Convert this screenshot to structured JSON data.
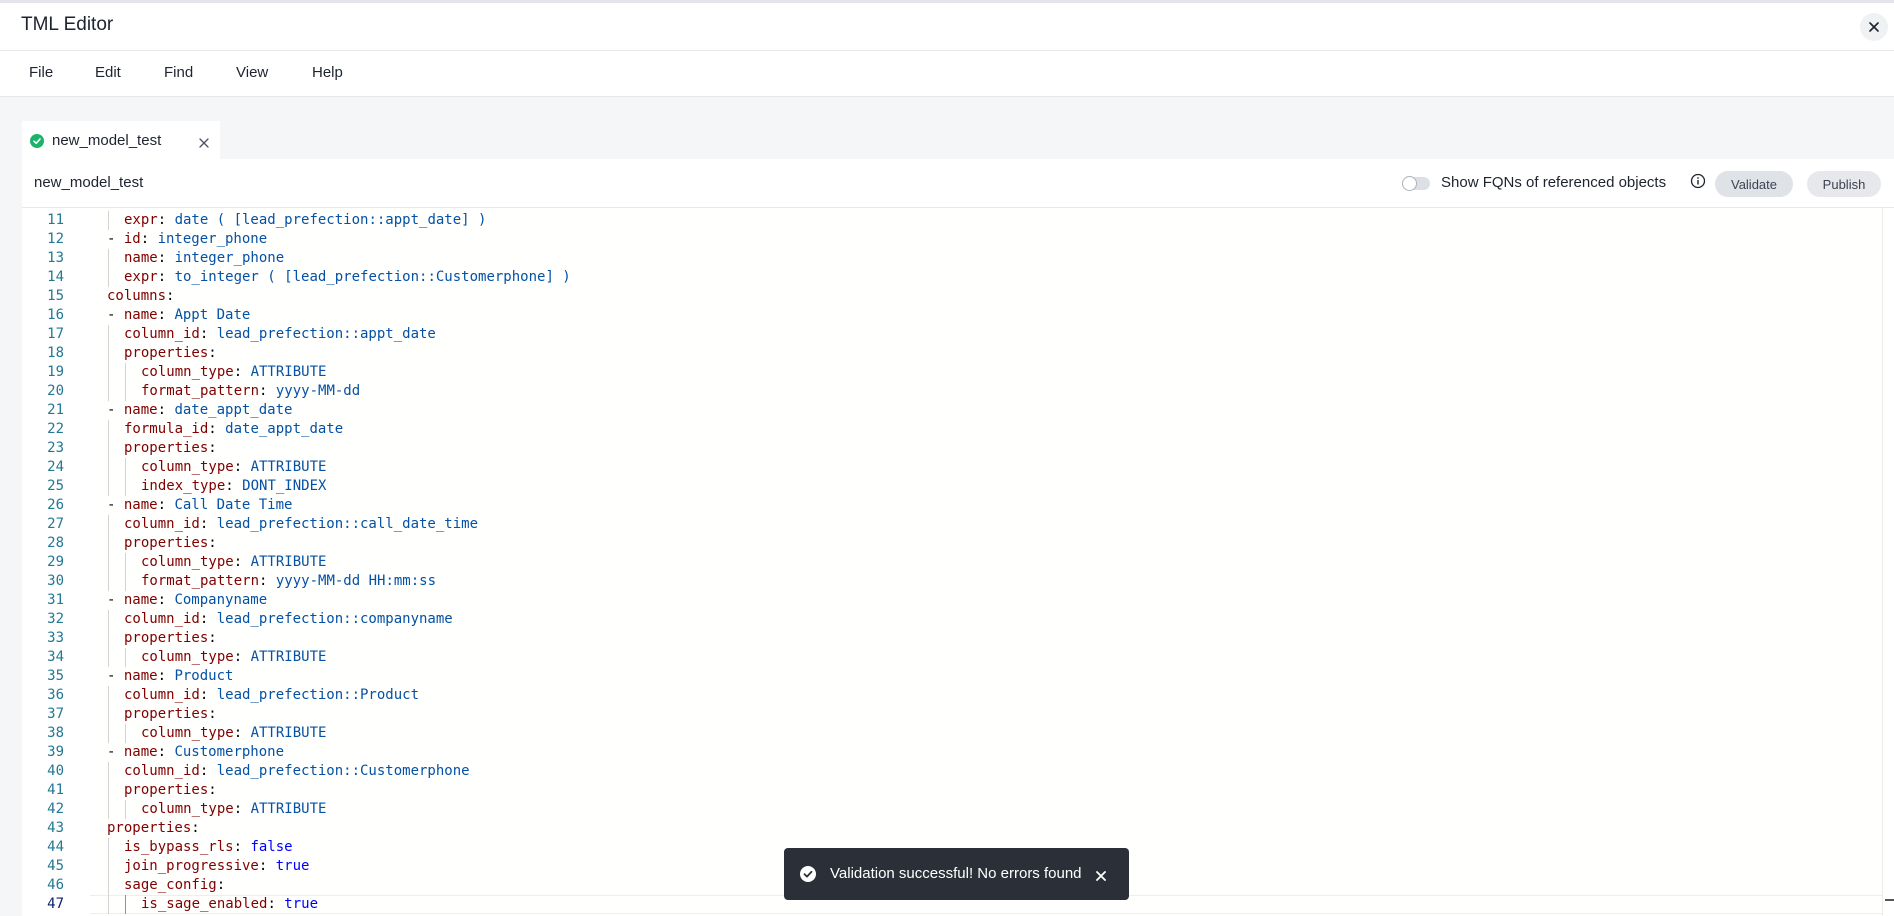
{
  "window": {
    "title": "TML Editor"
  },
  "menu": [
    "File",
    "Edit",
    "Find",
    "View",
    "Help"
  ],
  "tab": {
    "label": "new_model_test",
    "status": "valid"
  },
  "toolbar": {
    "file_name": "new_model_test",
    "fqn_toggle_label": "Show FQNs of referenced objects",
    "fqn_toggle_on": false,
    "validate_label": "Validate",
    "publish_label": "Publish"
  },
  "editor": {
    "active_line": 47,
    "lines": [
      {
        "n": "11",
        "depth": 1,
        "tokens": [
          {
            "t": "expr",
            "c": "k"
          },
          {
            "t": ": ",
            "c": "p"
          },
          {
            "t": "date ( [lead_prefection::appt_date] )",
            "c": "str"
          }
        ]
      },
      {
        "n": "12",
        "depth": 0,
        "tokens": [
          {
            "t": "- ",
            "c": "p"
          },
          {
            "t": "id",
            "c": "k"
          },
          {
            "t": ": ",
            "c": "p"
          },
          {
            "t": "integer_phone",
            "c": "str"
          }
        ]
      },
      {
        "n": "13",
        "depth": 1,
        "tokens": [
          {
            "t": "name",
            "c": "k"
          },
          {
            "t": ": ",
            "c": "p"
          },
          {
            "t": "integer_phone",
            "c": "str"
          }
        ]
      },
      {
        "n": "14",
        "depth": 1,
        "tokens": [
          {
            "t": "expr",
            "c": "k"
          },
          {
            "t": ": ",
            "c": "p"
          },
          {
            "t": "to_integer ( [lead_prefection::Customerphone] )",
            "c": "str"
          }
        ]
      },
      {
        "n": "15",
        "depth": 0,
        "tokens": [
          {
            "t": "columns",
            "c": "k"
          },
          {
            "t": ":",
            "c": "p"
          }
        ]
      },
      {
        "n": "16",
        "depth": 0,
        "tokens": [
          {
            "t": "- ",
            "c": "p"
          },
          {
            "t": "name",
            "c": "k"
          },
          {
            "t": ": ",
            "c": "p"
          },
          {
            "t": "Appt Date",
            "c": "str"
          }
        ]
      },
      {
        "n": "17",
        "depth": 1,
        "tokens": [
          {
            "t": "column_id",
            "c": "k"
          },
          {
            "t": ": ",
            "c": "p"
          },
          {
            "t": "lead_prefection::appt_date",
            "c": "str"
          }
        ]
      },
      {
        "n": "18",
        "depth": 1,
        "tokens": [
          {
            "t": "properties",
            "c": "k"
          },
          {
            "t": ":",
            "c": "p"
          }
        ]
      },
      {
        "n": "19",
        "depth": 2,
        "tokens": [
          {
            "t": "column_type",
            "c": "k"
          },
          {
            "t": ": ",
            "c": "p"
          },
          {
            "t": "ATTRIBUTE",
            "c": "str"
          }
        ]
      },
      {
        "n": "20",
        "depth": 2,
        "tokens": [
          {
            "t": "format_pattern",
            "c": "k"
          },
          {
            "t": ": ",
            "c": "p"
          },
          {
            "t": "yyyy-MM-dd",
            "c": "str"
          }
        ]
      },
      {
        "n": "21",
        "depth": 0,
        "tokens": [
          {
            "t": "- ",
            "c": "p"
          },
          {
            "t": "name",
            "c": "k"
          },
          {
            "t": ": ",
            "c": "p"
          },
          {
            "t": "date_appt_date",
            "c": "str"
          }
        ]
      },
      {
        "n": "22",
        "depth": 1,
        "tokens": [
          {
            "t": "formula_id",
            "c": "k"
          },
          {
            "t": ": ",
            "c": "p"
          },
          {
            "t": "date_appt_date",
            "c": "str"
          }
        ]
      },
      {
        "n": "23",
        "depth": 1,
        "tokens": [
          {
            "t": "properties",
            "c": "k"
          },
          {
            "t": ":",
            "c": "p"
          }
        ]
      },
      {
        "n": "24",
        "depth": 2,
        "tokens": [
          {
            "t": "column_type",
            "c": "k"
          },
          {
            "t": ": ",
            "c": "p"
          },
          {
            "t": "ATTRIBUTE",
            "c": "str"
          }
        ]
      },
      {
        "n": "25",
        "depth": 2,
        "tokens": [
          {
            "t": "index_type",
            "c": "k"
          },
          {
            "t": ": ",
            "c": "p"
          },
          {
            "t": "DONT_INDEX",
            "c": "str"
          }
        ]
      },
      {
        "n": "26",
        "depth": 0,
        "tokens": [
          {
            "t": "- ",
            "c": "p"
          },
          {
            "t": "name",
            "c": "k"
          },
          {
            "t": ": ",
            "c": "p"
          },
          {
            "t": "Call Date Time",
            "c": "str"
          }
        ]
      },
      {
        "n": "27",
        "depth": 1,
        "tokens": [
          {
            "t": "column_id",
            "c": "k"
          },
          {
            "t": ": ",
            "c": "p"
          },
          {
            "t": "lead_prefection::call_date_time",
            "c": "str"
          }
        ]
      },
      {
        "n": "28",
        "depth": 1,
        "tokens": [
          {
            "t": "properties",
            "c": "k"
          },
          {
            "t": ":",
            "c": "p"
          }
        ]
      },
      {
        "n": "29",
        "depth": 2,
        "tokens": [
          {
            "t": "column_type",
            "c": "k"
          },
          {
            "t": ": ",
            "c": "p"
          },
          {
            "t": "ATTRIBUTE",
            "c": "str"
          }
        ]
      },
      {
        "n": "30",
        "depth": 2,
        "tokens": [
          {
            "t": "format_pattern",
            "c": "k"
          },
          {
            "t": ": ",
            "c": "p"
          },
          {
            "t": "yyyy-MM-dd HH:mm:ss",
            "c": "str"
          }
        ]
      },
      {
        "n": "31",
        "depth": 0,
        "tokens": [
          {
            "t": "- ",
            "c": "p"
          },
          {
            "t": "name",
            "c": "k"
          },
          {
            "t": ": ",
            "c": "p"
          },
          {
            "t": "Companyname",
            "c": "str"
          }
        ]
      },
      {
        "n": "32",
        "depth": 1,
        "tokens": [
          {
            "t": "column_id",
            "c": "k"
          },
          {
            "t": ": ",
            "c": "p"
          },
          {
            "t": "lead_prefection::companyname",
            "c": "str"
          }
        ]
      },
      {
        "n": "33",
        "depth": 1,
        "tokens": [
          {
            "t": "properties",
            "c": "k"
          },
          {
            "t": ":",
            "c": "p"
          }
        ]
      },
      {
        "n": "34",
        "depth": 2,
        "tokens": [
          {
            "t": "column_type",
            "c": "k"
          },
          {
            "t": ": ",
            "c": "p"
          },
          {
            "t": "ATTRIBUTE",
            "c": "str"
          }
        ]
      },
      {
        "n": "35",
        "depth": 0,
        "tokens": [
          {
            "t": "- ",
            "c": "p"
          },
          {
            "t": "name",
            "c": "k"
          },
          {
            "t": ": ",
            "c": "p"
          },
          {
            "t": "Product",
            "c": "str"
          }
        ]
      },
      {
        "n": "36",
        "depth": 1,
        "tokens": [
          {
            "t": "column_id",
            "c": "k"
          },
          {
            "t": ": ",
            "c": "p"
          },
          {
            "t": "lead_prefection::Product",
            "c": "str"
          }
        ]
      },
      {
        "n": "37",
        "depth": 1,
        "tokens": [
          {
            "t": "properties",
            "c": "k"
          },
          {
            "t": ":",
            "c": "p"
          }
        ]
      },
      {
        "n": "38",
        "depth": 2,
        "tokens": [
          {
            "t": "column_type",
            "c": "k"
          },
          {
            "t": ": ",
            "c": "p"
          },
          {
            "t": "ATTRIBUTE",
            "c": "str"
          }
        ]
      },
      {
        "n": "39",
        "depth": 0,
        "tokens": [
          {
            "t": "- ",
            "c": "p"
          },
          {
            "t": "name",
            "c": "k"
          },
          {
            "t": ": ",
            "c": "p"
          },
          {
            "t": "Customerphone",
            "c": "str"
          }
        ]
      },
      {
        "n": "40",
        "depth": 1,
        "tokens": [
          {
            "t": "column_id",
            "c": "k"
          },
          {
            "t": ": ",
            "c": "p"
          },
          {
            "t": "lead_prefection::Customerphone",
            "c": "str"
          }
        ]
      },
      {
        "n": "41",
        "depth": 1,
        "tokens": [
          {
            "t": "properties",
            "c": "k"
          },
          {
            "t": ":",
            "c": "p"
          }
        ]
      },
      {
        "n": "42",
        "depth": 2,
        "tokens": [
          {
            "t": "column_type",
            "c": "k"
          },
          {
            "t": ": ",
            "c": "p"
          },
          {
            "t": "ATTRIBUTE",
            "c": "str"
          }
        ]
      },
      {
        "n": "43",
        "depth": 0,
        "tokens": [
          {
            "t": "properties",
            "c": "k"
          },
          {
            "t": ":",
            "c": "p"
          }
        ]
      },
      {
        "n": "44",
        "depth": 1,
        "tokens": [
          {
            "t": "is_bypass_rls",
            "c": "k"
          },
          {
            "t": ": ",
            "c": "p"
          },
          {
            "t": "false",
            "c": "bool"
          }
        ]
      },
      {
        "n": "45",
        "depth": 1,
        "tokens": [
          {
            "t": "join_progressive",
            "c": "k"
          },
          {
            "t": ": ",
            "c": "p"
          },
          {
            "t": "true",
            "c": "bool"
          }
        ]
      },
      {
        "n": "46",
        "depth": 1,
        "tokens": [
          {
            "t": "sage_config",
            "c": "k"
          },
          {
            "t": ":",
            "c": "p"
          }
        ]
      },
      {
        "n": "47",
        "depth": 2,
        "tokens": [
          {
            "t": "is_sage_enabled",
            "c": "k"
          },
          {
            "t": ": ",
            "c": "p"
          },
          {
            "t": "true",
            "c": "bool"
          }
        ]
      }
    ]
  },
  "toast": {
    "message": "Validation successful! No errors found"
  },
  "colors": {
    "key": "#800000",
    "string": "#0451a5",
    "boolean": "#0000ff",
    "line_number": "#237893",
    "success": "#1bb36a",
    "toast_bg": "#2b3038"
  }
}
